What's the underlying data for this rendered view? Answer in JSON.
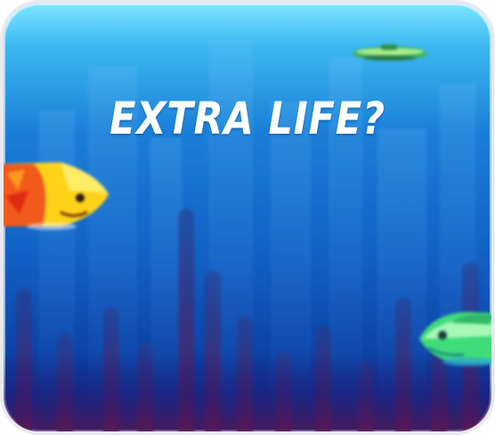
{
  "screen": {
    "title": "EXTRA LIFE?"
  },
  "sprites": {
    "yellow_fish": "yellow-fish-icon",
    "green_fish": "green-fish-icon",
    "submarine": "submarine-icon"
  },
  "colors": {
    "water_top": "#7ee6ff",
    "water_mid": "#1a7fd8",
    "water_bottom": "#0a2f8a",
    "title_text": "#ffffff",
    "border": "#e8eaf0"
  }
}
